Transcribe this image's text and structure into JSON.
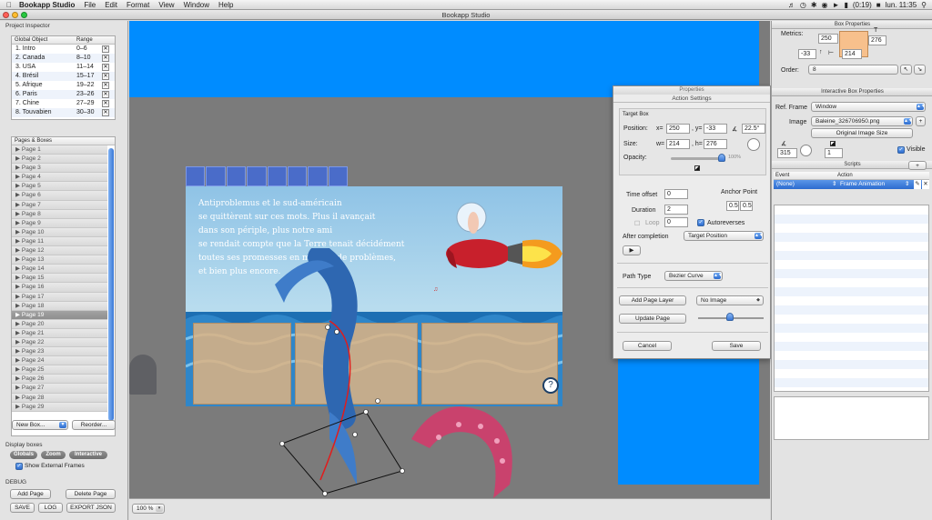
{
  "menubar": {
    "app_name": "Bookapp Studio",
    "items": [
      "File",
      "Edit",
      "Format",
      "View",
      "Window",
      "Help"
    ],
    "battery": "(0:19)",
    "clock": "lun. 11:35"
  },
  "window": {
    "title": "Bookapp Studio"
  },
  "project_inspector": {
    "title": "Project Inspector",
    "col_object": "Global Object",
    "col_range": "Range",
    "objects": [
      {
        "name": "1. Intro",
        "range": "0–6"
      },
      {
        "name": "2. Canada",
        "range": "8–10"
      },
      {
        "name": "3. USA",
        "range": "11–14"
      },
      {
        "name": "4. Brésil",
        "range": "15–17"
      },
      {
        "name": "5. Afrique",
        "range": "19–22"
      },
      {
        "name": "6. Paris",
        "range": "23–26"
      },
      {
        "name": "7. Chine",
        "range": "27–29"
      },
      {
        "name": "8. Touvabien",
        "range": "30–30"
      }
    ],
    "pages_title": "Pages & Boxes",
    "pages": [
      "Page 1",
      "Page 2",
      "Page 3",
      "Page 4",
      "Page 5",
      "Page 6",
      "Page 7",
      "Page 8",
      "Page 9",
      "Page 10",
      "Page 11",
      "Page 12",
      "Page 13",
      "Page 14",
      "Page 15",
      "Page 16",
      "Page 17",
      "Page 18",
      "Page 19",
      "Page 20",
      "Page 21",
      "Page 22",
      "Page 23",
      "Page 24",
      "Page 25",
      "Page 26",
      "Page 27",
      "Page 28",
      "Page 29"
    ],
    "selected_page": "Page 19",
    "new_box_label": "New Box...",
    "reorder_label": "Reorder...",
    "display_boxes_title": "Display boxes",
    "display_globals": "Globals",
    "display_zoom": "Zoom",
    "display_interactive": "Interactive",
    "show_external_frames": "Show External Frames",
    "debug_title": "DEBUG",
    "add_page": "Add Page",
    "delete_page": "Delete Page",
    "save": "SAVE",
    "log": "LOG",
    "export_json": "EXPORT JSON"
  },
  "canvas": {
    "story_lines": [
      "Antiproblemus et le sud-américain",
      "se quittèrent sur ces mots. Plus il avançait",
      "dans son périple, plus notre ami",
      "se rendait compte que la Terre tenait décidément",
      "toutes ses promesses en matière de problèmes,",
      "et bien plus encore."
    ],
    "zoom_value": "100 %"
  },
  "action_settings": {
    "panel_title": "Properties",
    "subtitle": "Action Settings",
    "target_box": "Target Box",
    "position_label": "Position:",
    "x_label": "x=",
    "x_value": "250",
    "y_label": ", y=",
    "y_value": "-33",
    "angle_label": "∡",
    "angle_value": "22.5°",
    "size_label": "Size:",
    "w_label": "w=",
    "w_value": "214",
    "h_label": ", h=",
    "h_value": "276",
    "opacity_label": "Opacity:",
    "opacity_value": "100%",
    "opacity_fraction": 1.0,
    "time_offset_label": "Time offset",
    "time_offset_value": "0",
    "duration_label": "Duration",
    "duration_value": "2",
    "loop_label": "Loop",
    "loop_value": "0",
    "anchor_label": "Anchor Point",
    "anchor_x": "0.5",
    "anchor_y": "0.5",
    "autoreverses_label": "Autoreverses",
    "after_completion_label": "After completion",
    "after_completion_value": "Target Position",
    "path_type_label": "Path Type",
    "path_type_value": "Bezier Curve",
    "add_page_layer": "Add Page Layer",
    "no_image": "No Image",
    "update_page": "Update Page",
    "cancel": "Cancel",
    "save": "Save"
  },
  "box_properties": {
    "title": "Box Properties",
    "metrics_label": "Metrics:",
    "x": "250",
    "y": "-33",
    "w": "214",
    "h": "276",
    "order_label": "Order:",
    "order_value": "8"
  },
  "interactive_props": {
    "title": "Interactive Box Properties",
    "ref_frame_label": "Ref. Frame",
    "ref_frame_value": "Window",
    "image_label": "Image",
    "image_value": "Baleine_326706950.png",
    "original_size": "Original Image Size",
    "rotation_value": "315",
    "opacity_value": "1",
    "visible_label": "Visible",
    "scripts_title": "Scripts",
    "event_col": "Event",
    "action_col": "Action",
    "event_value": "(None)",
    "action_value": "Frame Animation"
  },
  "colors": {
    "canvas_blue": "#008cff",
    "selection_blue": "#2d6ccf",
    "metrics_box": "#f7c08c"
  }
}
